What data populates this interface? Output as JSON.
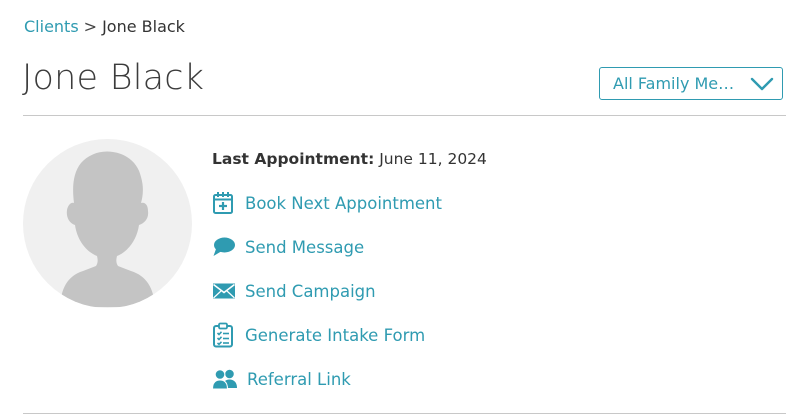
{
  "breadcrumb": {
    "root": "Clients",
    "separator": ">",
    "current": "Jone Black"
  },
  "page": {
    "title": "Jone Black"
  },
  "family_select": {
    "value": "All Family Me…",
    "icon": "chevron-down-icon"
  },
  "client": {
    "last_appointment_label": "Last Appointment:",
    "last_appointment_value": "June 11, 2024"
  },
  "actions": [
    {
      "label": "Book Next Appointment",
      "icon": "calendar-plus-icon"
    },
    {
      "label": "Send Message",
      "icon": "chat-bubble-icon"
    },
    {
      "label": "Send Campaign",
      "icon": "envelope-icon"
    },
    {
      "label": "Generate Intake Form",
      "icon": "clipboard-checklist-icon"
    },
    {
      "label": "Referral Link",
      "icon": "users-icon"
    }
  ],
  "colors": {
    "accent": "#2f9bb1",
    "text": "#333333",
    "divider": "#c8c8c8",
    "avatar_bg": "#f0f0f0",
    "avatar_silhouette": "#c4c4c4"
  }
}
